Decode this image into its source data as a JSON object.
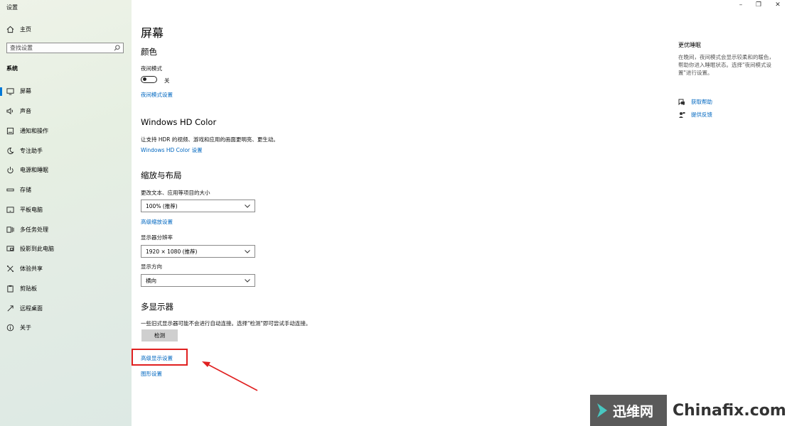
{
  "window": {
    "title": "设置",
    "minimize": "–",
    "restore": "❐",
    "close": "✕"
  },
  "sidebar": {
    "home_label": "主页",
    "search_placeholder": "查找设置",
    "section": "系统",
    "items": [
      {
        "label": "屏幕",
        "icon": "monitor-icon",
        "active": true
      },
      {
        "label": "声音",
        "icon": "speaker-icon"
      },
      {
        "label": "通知和操作",
        "icon": "notification-icon"
      },
      {
        "label": "专注助手",
        "icon": "moon-icon"
      },
      {
        "label": "电源和睡眠",
        "icon": "power-icon"
      },
      {
        "label": "存储",
        "icon": "storage-icon"
      },
      {
        "label": "平板电脑",
        "icon": "tablet-icon"
      },
      {
        "label": "多任务处理",
        "icon": "multitask-icon"
      },
      {
        "label": "投影到此电脑",
        "icon": "project-icon"
      },
      {
        "label": "体验共享",
        "icon": "share-icon"
      },
      {
        "label": "剪贴板",
        "icon": "clipboard-icon"
      },
      {
        "label": "远程桌面",
        "icon": "remote-desktop-icon"
      },
      {
        "label": "关于",
        "icon": "info-icon"
      }
    ]
  },
  "main": {
    "title": "屏幕",
    "color": {
      "heading": "颜色",
      "night_mode_label": "夜间模式",
      "toggle_state": "关",
      "night_mode_link": "夜间模式设置"
    },
    "hdr": {
      "heading": "Windows HD Color",
      "desc": "让支持 HDR 的视频、游戏和应用的画面更明亮、更生动。",
      "link": "Windows HD Color 设置"
    },
    "layout": {
      "heading": "缩放与布局",
      "scale_label": "更改文本、应用等项目的大小",
      "scale_value": "100% (推荐)",
      "advanced_scale_link": "高级缩放设置",
      "resolution_label": "显示器分辨率",
      "resolution_value": "1920 × 1080 (推荐)",
      "orientation_label": "显示方向",
      "orientation_value": "横向"
    },
    "multi": {
      "heading": "多显示器",
      "desc": "一些旧式显示器可能不会进行自动连接。选择\"检测\"即可尝试手动连接。",
      "detect_button": "检测",
      "advanced_display_link": "高级显示设置",
      "graphics_link": "图形设置"
    }
  },
  "right": {
    "title": "更优睡眠",
    "desc": "在晚间，夜间模式会显示较柔和的暖色，帮助你进入睡眠状态。选择\"夜间模式设置\"进行设置。",
    "help_link": "获取帮助",
    "feedback_link": "提供反馈"
  },
  "watermark": {
    "cn": "迅维网",
    "en": "Chinafix.com"
  },
  "colors": {
    "accent": "#0067c0",
    "highlight": "#e02020",
    "watermark_bg": "#5a5a5a"
  }
}
